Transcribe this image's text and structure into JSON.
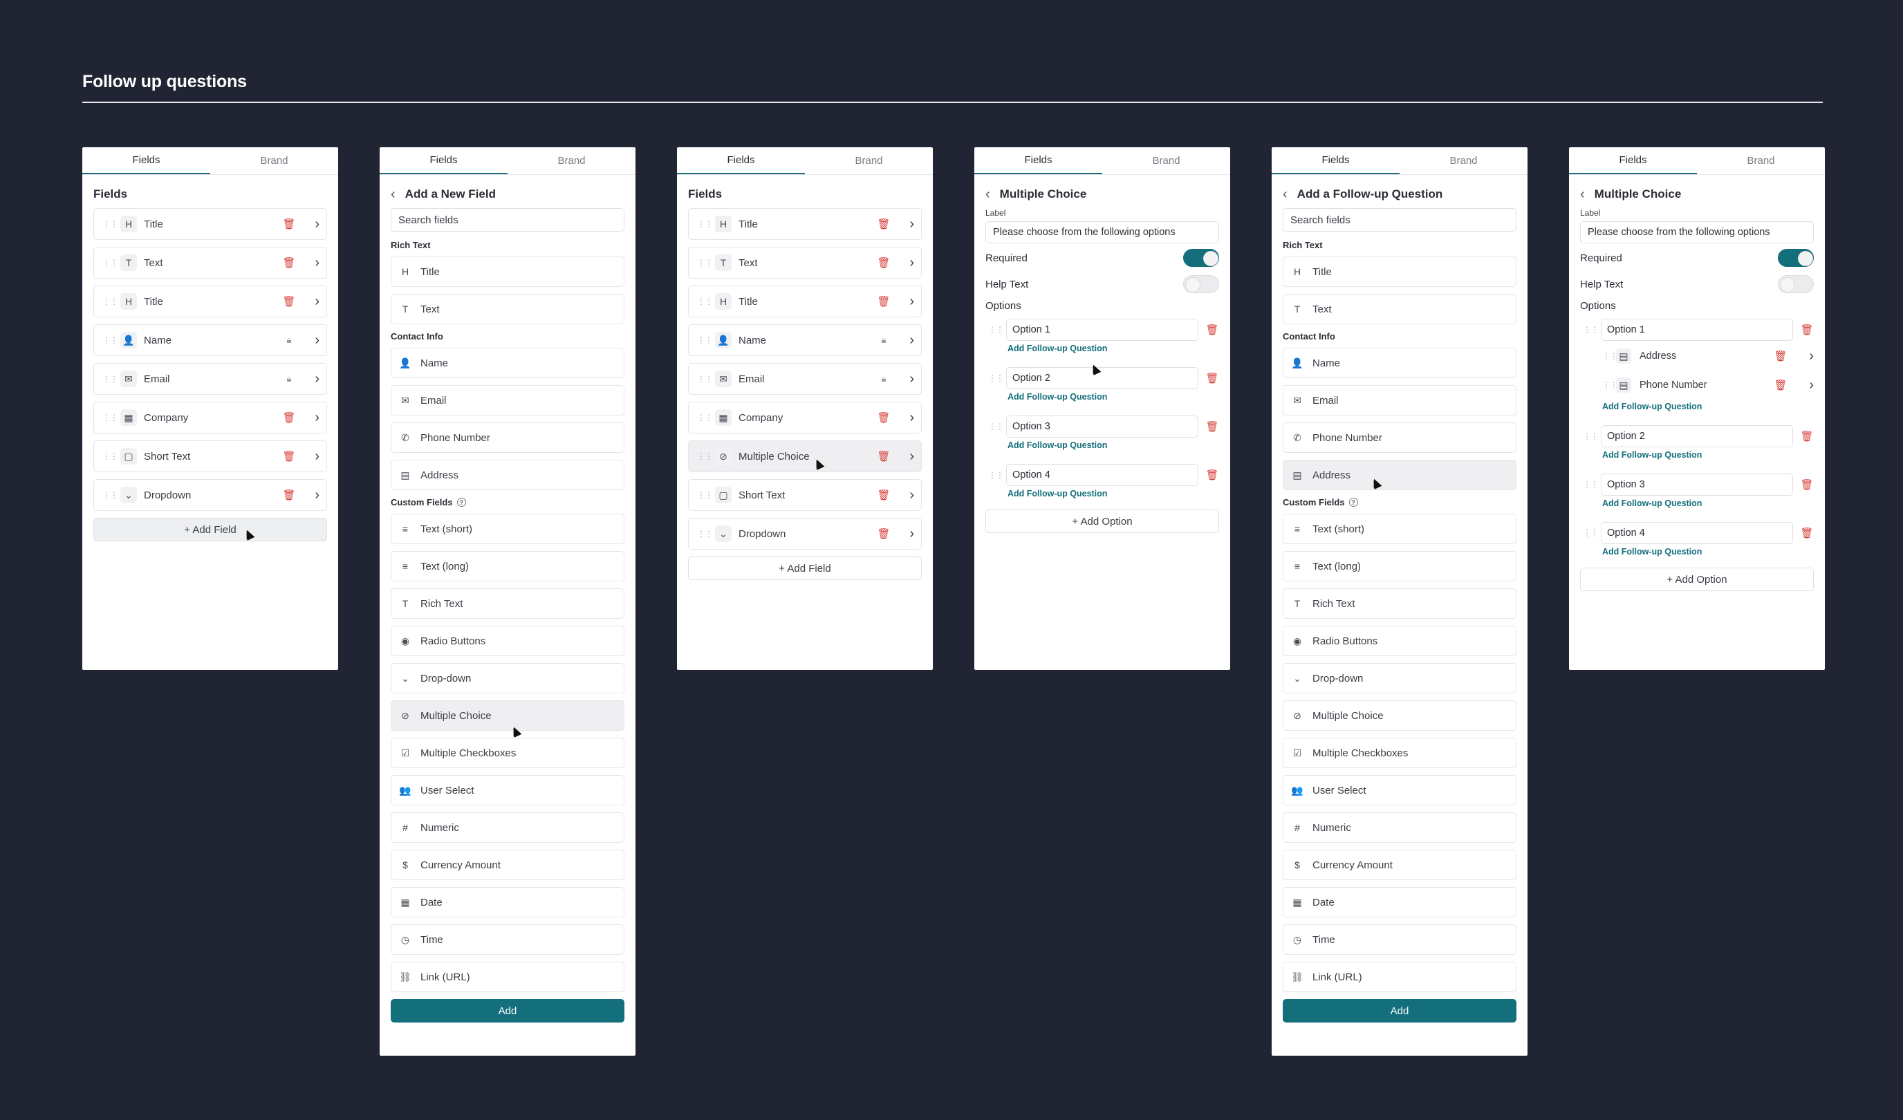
{
  "page_title": "Follow up questions",
  "tabs": {
    "fields": "Fields",
    "brand": "Brand"
  },
  "panel1": {
    "header": "Fields",
    "items": [
      {
        "icon": "H",
        "label": "Title",
        "action": "delete"
      },
      {
        "icon": "T",
        "label": "Text",
        "action": "delete"
      },
      {
        "icon": "H",
        "label": "Title",
        "action": "delete"
      },
      {
        "icon": "👤",
        "label": "Name",
        "action": "lock"
      },
      {
        "icon": "✉",
        "label": "Email",
        "action": "lock"
      },
      {
        "icon": "▦",
        "label": "Company",
        "action": "delete"
      },
      {
        "icon": "▢",
        "label": "Short Text",
        "action": "delete"
      },
      {
        "icon": "⌄",
        "label": "Dropdown",
        "action": "delete"
      }
    ],
    "add_label": "+  Add Field"
  },
  "panel2": {
    "header": "Add a New Field",
    "search_placeholder": "Search fields",
    "section_rich": "Rich Text",
    "rich": [
      {
        "icon": "H",
        "label": "Title"
      },
      {
        "icon": "T",
        "label": "Text"
      }
    ],
    "section_contact": "Contact Info",
    "contact": [
      {
        "icon": "👤",
        "label": "Name"
      },
      {
        "icon": "✉",
        "label": "Email"
      },
      {
        "icon": "✆",
        "label": "Phone Number"
      },
      {
        "icon": "▤",
        "label": "Address"
      }
    ],
    "section_custom": "Custom Fields",
    "custom": [
      {
        "icon": "≡",
        "label": "Text (short)"
      },
      {
        "icon": "≡",
        "label": "Text (long)"
      },
      {
        "icon": "T",
        "label": "Rich Text"
      },
      {
        "icon": "◉",
        "label": "Radio Buttons"
      },
      {
        "icon": "⌄",
        "label": "Drop-down"
      },
      {
        "icon": "⊘",
        "label": "Multiple Choice"
      },
      {
        "icon": "☑",
        "label": "Multiple Checkboxes"
      },
      {
        "icon": "👥",
        "label": "User Select"
      },
      {
        "icon": "#",
        "label": "Numeric"
      },
      {
        "icon": "$",
        "label": "Currency Amount"
      },
      {
        "icon": "▦",
        "label": "Date"
      },
      {
        "icon": "◷",
        "label": "Time"
      },
      {
        "icon": "⛓",
        "label": "Link (URL)"
      }
    ],
    "add_label": "Add"
  },
  "panel3": {
    "header": "Fields",
    "items": [
      {
        "icon": "H",
        "label": "Title",
        "action": "delete"
      },
      {
        "icon": "T",
        "label": "Text",
        "action": "delete"
      },
      {
        "icon": "H",
        "label": "Title",
        "action": "delete"
      },
      {
        "icon": "👤",
        "label": "Name",
        "action": "lock"
      },
      {
        "icon": "✉",
        "label": "Email",
        "action": "lock"
      },
      {
        "icon": "▦",
        "label": "Company",
        "action": "delete"
      },
      {
        "icon": "⊘",
        "label": "Multiple Choice",
        "action": "delete"
      },
      {
        "icon": "▢",
        "label": "Short Text",
        "action": "delete"
      },
      {
        "icon": "⌄",
        "label": "Dropdown",
        "action": "delete"
      }
    ],
    "add_label": "+  Add Field"
  },
  "panel4": {
    "header": "Multiple Choice",
    "label_caption": "Label",
    "label_value": "Please choose from the following options",
    "required": "Required",
    "help_text": "Help Text",
    "options_label": "Options",
    "options": [
      "Option 1",
      "Option 2",
      "Option 3",
      "Option 4"
    ],
    "follow_up": "Add Follow-up Question",
    "add_option": "+  Add Option"
  },
  "panel5": {
    "header": "Add a Follow-up Question",
    "search_placeholder": "Search fields",
    "section_rich": "Rich Text",
    "rich": [
      {
        "icon": "H",
        "label": "Title"
      },
      {
        "icon": "T",
        "label": "Text"
      }
    ],
    "section_contact": "Contact Info",
    "contact": [
      {
        "icon": "👤",
        "label": "Name"
      },
      {
        "icon": "✉",
        "label": "Email"
      },
      {
        "icon": "✆",
        "label": "Phone Number"
      },
      {
        "icon": "▤",
        "label": "Address"
      }
    ],
    "section_custom": "Custom Fields",
    "custom": [
      {
        "icon": "≡",
        "label": "Text (short)"
      },
      {
        "icon": "≡",
        "label": "Text (long)"
      },
      {
        "icon": "T",
        "label": "Rich Text"
      },
      {
        "icon": "◉",
        "label": "Radio Buttons"
      },
      {
        "icon": "⌄",
        "label": "Drop-down"
      },
      {
        "icon": "⊘",
        "label": "Multiple Choice"
      },
      {
        "icon": "☑",
        "label": "Multiple Checkboxes"
      },
      {
        "icon": "👥",
        "label": "User Select"
      },
      {
        "icon": "#",
        "label": "Numeric"
      },
      {
        "icon": "$",
        "label": "Currency Amount"
      },
      {
        "icon": "▦",
        "label": "Date"
      },
      {
        "icon": "◷",
        "label": "Time"
      },
      {
        "icon": "⛓",
        "label": "Link (URL)"
      }
    ],
    "add_label": "Add"
  },
  "panel6": {
    "header": "Multiple Choice",
    "label_caption": "Label",
    "label_value": "Please choose from the following options",
    "required": "Required",
    "help_text": "Help Text",
    "options_label": "Options",
    "options": [
      "Option 1",
      "Option 2",
      "Option 3",
      "Option 4"
    ],
    "followups": [
      {
        "icon": "▤",
        "label": "Address"
      },
      {
        "icon": "▤",
        "label": "Phone Number"
      }
    ],
    "follow_up": "Add Follow-up Question",
    "add_option": "+  Add Option"
  },
  "colors": {
    "background": "#212433",
    "accent": "#146f7c",
    "danger": "#d6403a"
  }
}
